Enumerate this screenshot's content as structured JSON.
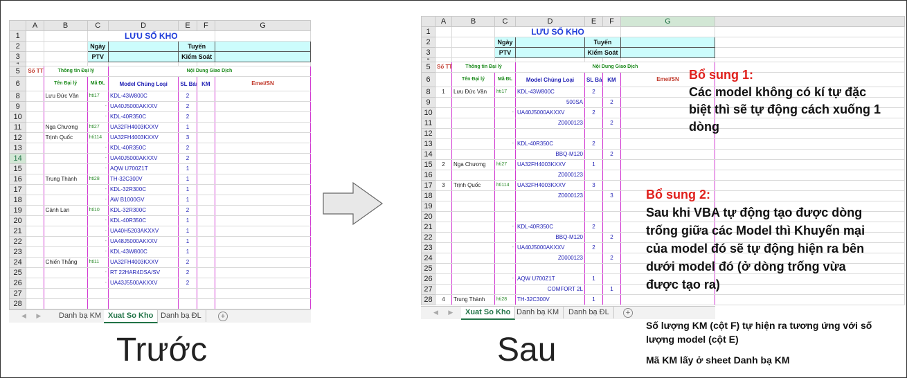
{
  "caption_before": "Trước",
  "caption_after": "Sau",
  "before": {
    "columns": [
      "A",
      "B",
      "C",
      "D",
      "E",
      "F",
      "G"
    ],
    "title": "LƯU SỔ KHO",
    "labels": {
      "ngay": "Ngày",
      "ptv": "PTV",
      "tuyen": "Tuyến",
      "kiem_soat": "Kiểm Soát"
    },
    "headers": {
      "so_tt": "Số TT",
      "thong_tin": "Thông tin Đại lý",
      "noi_dung": "Nội Dung Giao Dịch",
      "ten_dai_ly": "Tên Đại lý",
      "ma_dl": "Mã ĐL",
      "model": "Model Chủng Loại",
      "sl_ban": "SL Bán",
      "km": "KM",
      "emei": "Emei/SN"
    },
    "rows": [
      {
        "n": "8",
        "name": "Lưu Đức Vân",
        "ma": "hti17",
        "model": "KDL-43W800C",
        "sl": "2"
      },
      {
        "n": "9",
        "name": "",
        "ma": "-",
        "model": "UA40J5000AKXXV",
        "sl": "2"
      },
      {
        "n": "10",
        "name": "",
        "ma": "-",
        "model": "KDL-40R350C",
        "sl": "2"
      },
      {
        "n": "11",
        "name": "Nga Chương",
        "ma": "hti27",
        "model": "UA32FH4003KXXV",
        "sl": "1"
      },
      {
        "n": "12",
        "name": "Trịnh Quốc",
        "ma": "hti114",
        "model": "UA32FH4003KXXV",
        "sl": "3"
      },
      {
        "n": "13",
        "name": "",
        "ma": "-",
        "model": "KDL-40R350C",
        "sl": "2"
      },
      {
        "n": "14",
        "name": "",
        "ma": "-",
        "model": "UA40J5000AKXXV",
        "sl": "2"
      },
      {
        "n": "15",
        "name": "",
        "ma": "-",
        "model": "AQW U700Z1T",
        "sl": "1"
      },
      {
        "n": "16",
        "name": "Trung Thành",
        "ma": "hti28",
        "model": "TH-32C300V",
        "sl": "1"
      },
      {
        "n": "17",
        "name": "",
        "ma": "-",
        "model": "KDL-32R300C",
        "sl": "1"
      },
      {
        "n": "18",
        "name": "",
        "ma": "-",
        "model": "AW B1000GV",
        "sl": "1"
      },
      {
        "n": "19",
        "name": "Cảnh Lan",
        "ma": "hti10",
        "model": "KDL-32R300C",
        "sl": "2"
      },
      {
        "n": "20",
        "name": "",
        "ma": "-",
        "model": "KDL-40R350C",
        "sl": "1"
      },
      {
        "n": "21",
        "name": "",
        "ma": "-",
        "model": "UA40H5203AKXXV",
        "sl": "1"
      },
      {
        "n": "22",
        "name": "",
        "ma": "-",
        "model": "UA48J5000AKXXV",
        "sl": "1"
      },
      {
        "n": "23",
        "name": "",
        "ma": "-",
        "model": "KDL-43W800C",
        "sl": "1"
      },
      {
        "n": "24",
        "name": "Chiến Thắng",
        "ma": "hti11",
        "model": "UA32FH4003KXXV",
        "sl": "2"
      },
      {
        "n": "25",
        "name": "",
        "ma": "-",
        "model": "RT 22HAR4DSA/SV",
        "sl": "2"
      },
      {
        "n": "26",
        "name": "",
        "ma": "-",
        "model": "UA43J5500AKXXV",
        "sl": "2"
      },
      {
        "n": "27",
        "name": "",
        "ma": "",
        "model": "",
        "sl": ""
      },
      {
        "n": "28",
        "name": "",
        "ma": "",
        "model": "",
        "sl": ""
      }
    ],
    "tabs": [
      "Danh bạ KM",
      "Xuat So Kho",
      "Danh bạ ĐL"
    ]
  },
  "after": {
    "columns": [
      "A",
      "B",
      "C",
      "D",
      "E",
      "F",
      "G"
    ],
    "title": "LƯU SỔ KHO",
    "labels": {
      "ngay": "Ngày",
      "ptv": "PTV",
      "tuyen": "Tuyến",
      "kiem_soat": "Kiểm Soát"
    },
    "headers": {
      "so_tt": "Số TT",
      "thong_tin": "Thông tin Đại lý",
      "noi_dung": "Nội Dung Giao Dịch",
      "ten_dai_ly": "Tên Đại lý",
      "ma_dl": "Mã ĐL",
      "model": "Model Chủng Loại",
      "sl_ban": "SL Bán",
      "km": "KM",
      "emei": "Emei/SN"
    },
    "rows": [
      {
        "n": "8",
        "stt": "1",
        "name": "Lưu Đức Vân",
        "ma": "hti17",
        "model": "KDL-43W800C",
        "promo": "",
        "sl": "2",
        "km": ""
      },
      {
        "n": "9",
        "stt": "",
        "name": "",
        "ma": "",
        "model": "",
        "promo": "500SA",
        "sl": "",
        "km": "2"
      },
      {
        "n": "10",
        "stt": "",
        "name": "",
        "ma": "-",
        "model": "UA40J5000AKXXV",
        "promo": "",
        "sl": "2",
        "km": ""
      },
      {
        "n": "11",
        "stt": "",
        "name": "",
        "ma": "",
        "model": "",
        "promo": "Z0000123",
        "sl": "",
        "km": "2"
      },
      {
        "n": "12",
        "stt": "",
        "name": "",
        "ma": "",
        "model": "",
        "promo": "",
        "sl": "",
        "km": ""
      },
      {
        "n": "13",
        "stt": "",
        "name": "",
        "ma": "-",
        "model": "KDL-40R350C",
        "promo": "",
        "sl": "2",
        "km": ""
      },
      {
        "n": "14",
        "stt": "",
        "name": "",
        "ma": "",
        "model": "",
        "promo": "BBQ-M120",
        "sl": "",
        "km": "2"
      },
      {
        "n": "15",
        "stt": "2",
        "name": "Nga Chương",
        "ma": "hti27",
        "model": "UA32FH4003KXXV",
        "promo": "",
        "sl": "1",
        "km": ""
      },
      {
        "n": "16",
        "stt": "",
        "name": "",
        "ma": "",
        "model": "",
        "promo": "Z0000123",
        "sl": "",
        "km": ""
      },
      {
        "n": "17",
        "stt": "3",
        "name": "Trịnh Quốc",
        "ma": "hti114",
        "model": "UA32FH4003KXXV",
        "promo": "",
        "sl": "3",
        "km": ""
      },
      {
        "n": "18",
        "stt": "",
        "name": "",
        "ma": "",
        "model": "",
        "promo": "Z0000123",
        "sl": "",
        "km": "3"
      },
      {
        "n": "19",
        "stt": "",
        "name": "",
        "ma": "",
        "model": "",
        "promo": "",
        "sl": "",
        "km": ""
      },
      {
        "n": "20",
        "stt": "",
        "name": "",
        "ma": "",
        "model": "",
        "promo": "",
        "sl": "",
        "km": ""
      },
      {
        "n": "21",
        "stt": "",
        "name": "",
        "ma": "-",
        "model": "KDL-40R350C",
        "promo": "",
        "sl": "2",
        "km": ""
      },
      {
        "n": "22",
        "stt": "",
        "name": "",
        "ma": "",
        "model": "",
        "promo": "BBQ-M120",
        "sl": "",
        "km": "2"
      },
      {
        "n": "23",
        "stt": "",
        "name": "",
        "ma": "-",
        "model": "UA40J5000AKXXV",
        "promo": "",
        "sl": "2",
        "km": ""
      },
      {
        "n": "24",
        "stt": "",
        "name": "",
        "ma": "",
        "model": "",
        "promo": "Z0000123",
        "sl": "",
        "km": "2"
      },
      {
        "n": "25",
        "stt": "",
        "name": "",
        "ma": "",
        "model": "",
        "promo": "",
        "sl": "",
        "km": ""
      },
      {
        "n": "26",
        "stt": "",
        "name": "",
        "ma": "-",
        "model": "AQW U700Z1T",
        "promo": "",
        "sl": "1",
        "km": ""
      },
      {
        "n": "27",
        "stt": "",
        "name": "",
        "ma": "",
        "model": "",
        "promo": "COMFORT 2L",
        "sl": "",
        "km": "1"
      },
      {
        "n": "28",
        "stt": "4",
        "name": "Trung Thành",
        "ma": "hti28",
        "model": "TH-32C300V",
        "promo": "",
        "sl": "1",
        "km": ""
      }
    ],
    "tabs": [
      "Xuat So Kho",
      "Danh bạ KM",
      "Danh bạ ĐL"
    ]
  },
  "notes": {
    "n1_head": "Bổ sung 1:",
    "n1_body": "Các model không có kí tự đặc biệt thì sẽ tự động cách xuống 1 dòng",
    "n2_head": "Bổ sung 2:",
    "n2_body": "Sau khi VBA tự động tạo được dòng trống giữa các Model thì Khuyến mại của model đó sẽ tự động hiện ra bên dưới model đó (ở dòng trống vừa được tạo ra)",
    "n3": "Số lượng KM (cột F) tự hiện ra tương ứng với số lượng model (cột E)",
    "n4": "Mã KM lấy ở sheet Danh bạ KM"
  }
}
